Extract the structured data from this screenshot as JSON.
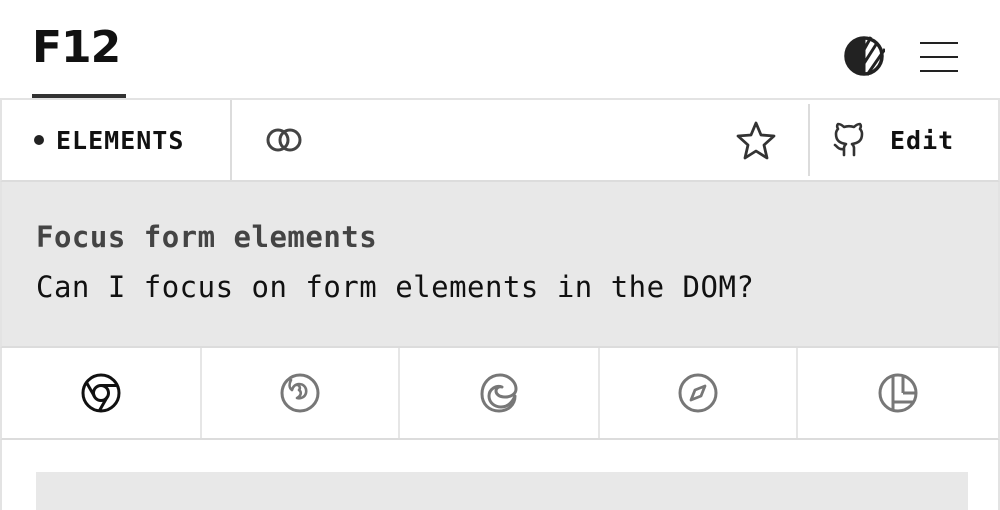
{
  "header": {
    "logo_text": "F12",
    "theme_icon": "theme-toggle-icon",
    "menu_icon": "hamburger-menu-icon"
  },
  "toolbar": {
    "category_label": "ELEMENTS",
    "link_icon": "link-icon",
    "star_icon": "star-icon",
    "github_icon": "github-icon",
    "edit_label": "Edit"
  },
  "question": {
    "title": "Focus form elements",
    "text": "Can I focus on form elements in the DOM?"
  },
  "browsers": [
    {
      "name": "chrome",
      "icon": "chrome-icon",
      "active": true
    },
    {
      "name": "firefox",
      "icon": "firefox-icon",
      "active": false
    },
    {
      "name": "edge",
      "icon": "edge-icon",
      "active": false
    },
    {
      "name": "safari",
      "icon": "safari-icon",
      "active": false
    },
    {
      "name": "polypane",
      "icon": "polypane-icon",
      "active": false
    }
  ],
  "colors": {
    "panel_bg": "#e8e8e8",
    "active_icon": "#111111",
    "inactive_icon": "#777777",
    "border": "#dcdcdc"
  }
}
